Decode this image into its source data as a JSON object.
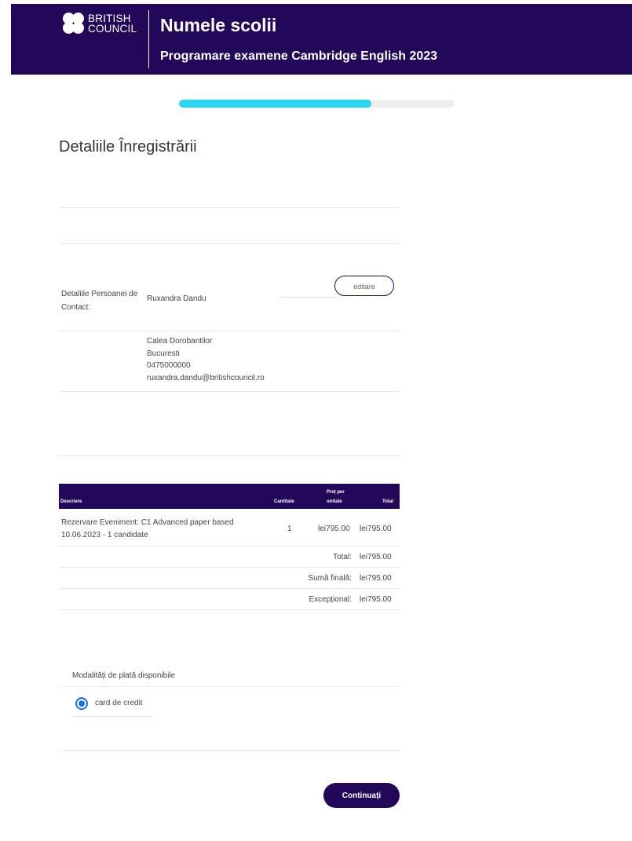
{
  "header": {
    "brand_line1": "BRITISH",
    "brand_line2": "COUNCIL",
    "school_name": "Numele scolii",
    "subtitle": "Programare examene Cambridge English 2023"
  },
  "progress": {
    "fraction": 0.7
  },
  "page_title": "Detaliile Înregistrării",
  "contact": {
    "label": "Detaliile Persoanei de Contact:",
    "name": "Ruxandra Dandu",
    "edit_label": "editare",
    "address_lines": [
      "Calea Dorobantilor",
      "Bucuresti",
      "0475000000",
      "ruxandra.dandu@britishcouncil.ro"
    ]
  },
  "order": {
    "headers": {
      "description": "Descriere",
      "quantity": "Cantitate",
      "unit_price_line1": "Preț per",
      "unit_price_line2": "unitate",
      "total": "Total"
    },
    "item": {
      "description_line1": "Rezervare Eveniment: C1 Advanced paper based",
      "description_line2": "10.06.2023 - 1 candidate",
      "quantity": "1",
      "unit_price": "lei795.00",
      "total": "lei795.00"
    },
    "summary": [
      {
        "label": "Total:",
        "value": "lei795.00"
      },
      {
        "label": "Sumă finală:",
        "value": "lei795.00"
      },
      {
        "label": "Excepțional:",
        "value": "lei795.00"
      }
    ]
  },
  "payment": {
    "title": "Modalități de plată disponibile",
    "option_label": "card de credit"
  },
  "continue_label": "Continuați",
  "colors": {
    "brand": "#23085a",
    "progress": "#26d6f5",
    "radio": "#1a73e8"
  }
}
